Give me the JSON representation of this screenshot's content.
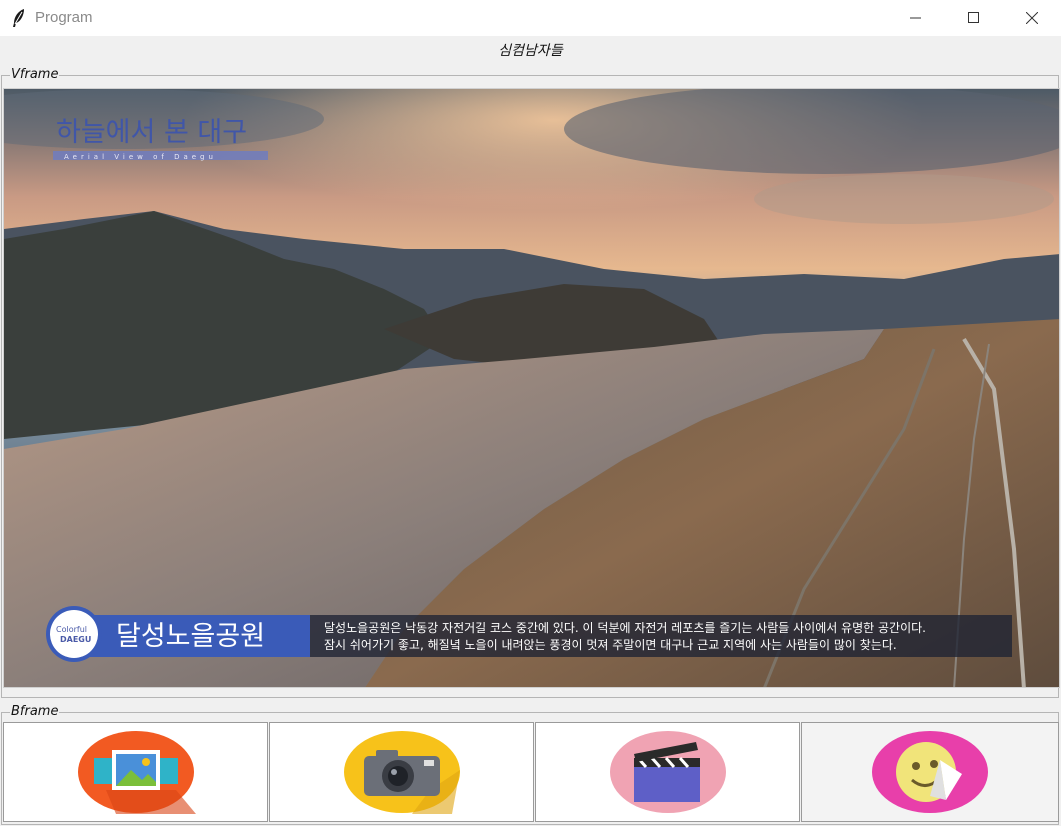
{
  "window": {
    "title": "Program",
    "controls": [
      "minimize",
      "maximize",
      "close"
    ]
  },
  "heading": "심컴남자들",
  "vframe": {
    "label": "Vframe",
    "video": {
      "title": "하늘에서 본 대구",
      "subtitle": "Aerial View of Daegu",
      "logo_text_1": "Colorful",
      "logo_text_2": "DAEGU",
      "place_name": "달성노을공원",
      "caption_line1": "달성노을공원은 낙동강 자전거길 코스 중간에 있다. 이 덕분에 자전거 레포츠를 즐기는 사람들 사이에서 유명한 공간이다.",
      "caption_line2": "잠시 쉬어가기 좋고, 해질녘 노을이 내려앉는 풍경이 멋져 주말이면 대구나 근교 지역에 사는 사람들이 많이 찾는다."
    }
  },
  "bframe": {
    "label": "Bframe",
    "buttons": [
      {
        "icon": "picture-icon",
        "color": "#f25a22"
      },
      {
        "icon": "camera-icon",
        "color": "#f7c21a"
      },
      {
        "icon": "clapperboard-icon",
        "color": "#f0a3b3"
      },
      {
        "icon": "sticker-face-icon",
        "color": "#e83faa"
      }
    ]
  }
}
